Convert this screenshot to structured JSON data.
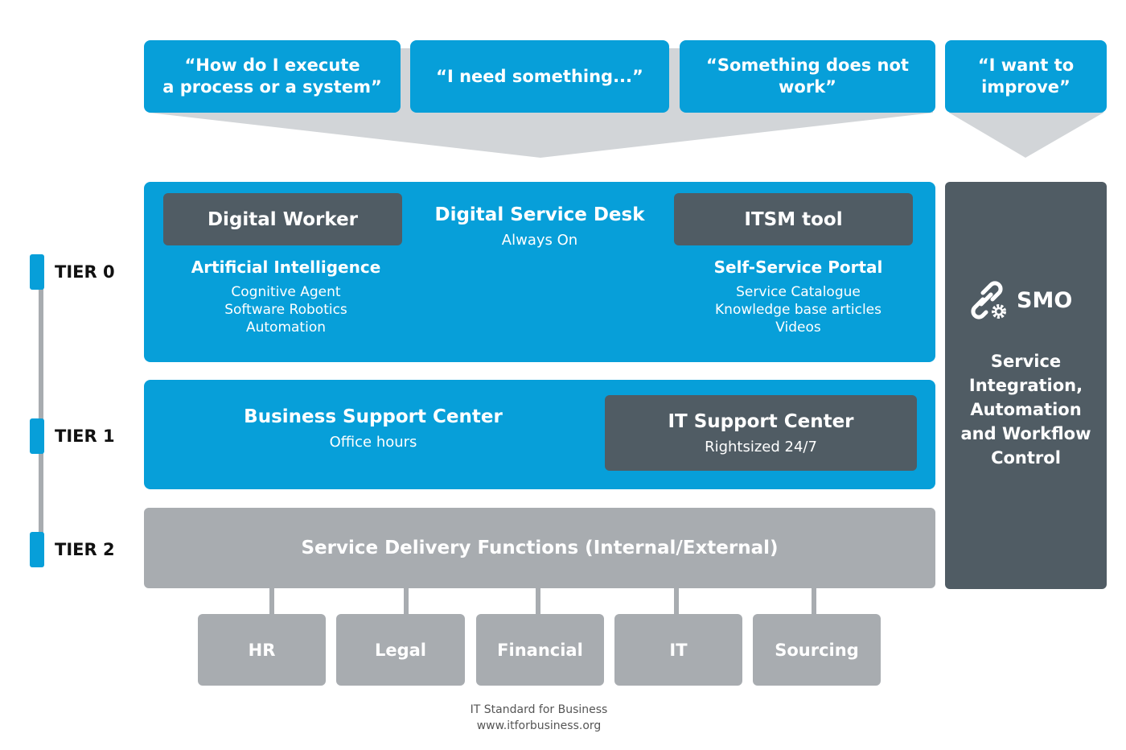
{
  "questions": [
    "“How do I execute\na process or a system”",
    "“I need something...”",
    "“Something does not work”",
    "“I want to\nimprove”"
  ],
  "tier0": {
    "digital_worker": "Digital Worker",
    "ai_title": "Artificial Intelligence",
    "ai_items": [
      "Cognitive Agent",
      "Software Robotics",
      "Automation"
    ],
    "desk_title": "Digital Service Desk",
    "desk_sub": "Always On",
    "itsm": "ITSM tool",
    "portal_title": "Self-Service Portal",
    "portal_items": [
      "Service Catalogue",
      "Knowledge base articles",
      "Videos"
    ]
  },
  "tier1": {
    "bsc_title": "Business Support Center",
    "bsc_sub": "Office hours",
    "itsc_title": "IT Support Center",
    "itsc_sub": "Rightsized 24/7"
  },
  "tier2": {
    "title": "Service Delivery Functions (Internal/External)",
    "functions": [
      "HR",
      "Legal",
      "Financial",
      "IT",
      "Sourcing"
    ]
  },
  "smo": {
    "icon": "link-gear-icon",
    "title": "SMO",
    "desc": "Service Integration, Automation and Workflow Control"
  },
  "tiers": [
    "TIER 0",
    "TIER 1",
    "TIER 2"
  ],
  "footer": {
    "line1": "IT Standard for Business",
    "line2": "www.itforbusiness.org"
  },
  "colors": {
    "blue": "#079fd9",
    "dark": "#505c64",
    "grey": "#a8acb0",
    "arrow": "#d2d5d8"
  }
}
